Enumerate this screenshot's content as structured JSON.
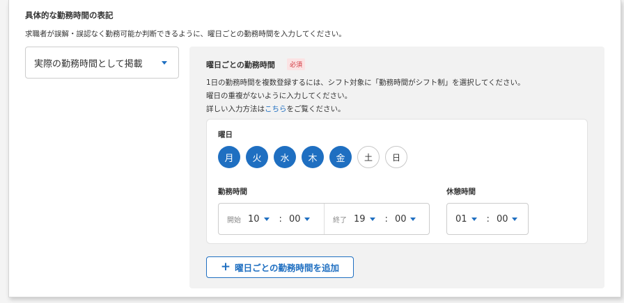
{
  "section": {
    "title": "具体的な勤務時間の表記",
    "description": "求職者が誤解・誤認なく勤務可能か判断できるように、曜日ごとの勤務時間を入力してください。"
  },
  "display_select": {
    "value": "実際の勤務時間として掲載",
    "icon": "caret-down-icon"
  },
  "panel": {
    "title": "曜日ごとの勤務時間",
    "required_badge": "必須",
    "info_line1": "1日の勤務時間を複数登録するには、シフト対象に「勤務時間がシフト制」を選択してください。",
    "info_line2": "曜日の重複がないように入力してください。",
    "info_line3_prefix": "詳しい入力方法は",
    "info_line3_link": "こちら",
    "info_line3_suffix": "をご覧ください。"
  },
  "weekday": {
    "label": "曜日",
    "days": [
      {
        "label": "月",
        "selected": true
      },
      {
        "label": "火",
        "selected": true
      },
      {
        "label": "水",
        "selected": true
      },
      {
        "label": "木",
        "selected": true
      },
      {
        "label": "金",
        "selected": true
      },
      {
        "label": "土",
        "selected": false
      },
      {
        "label": "日",
        "selected": false
      }
    ]
  },
  "work_time": {
    "label": "勤務時間",
    "start": {
      "label": "開始",
      "hour": "10",
      "colon": ":",
      "minute": "00"
    },
    "end": {
      "label": "終了",
      "hour": "19",
      "colon": ":",
      "minute": "00"
    }
  },
  "break_time": {
    "label": "休憩時間",
    "hour": "01",
    "colon": ":",
    "minute": "00"
  },
  "add_button": {
    "label": "曜日ごとの勤務時間を追加",
    "icon": "plus-icon"
  },
  "colors": {
    "accent": "#1f6fc1",
    "required": "#d0323a",
    "panel_bg": "#f2f2f2"
  }
}
